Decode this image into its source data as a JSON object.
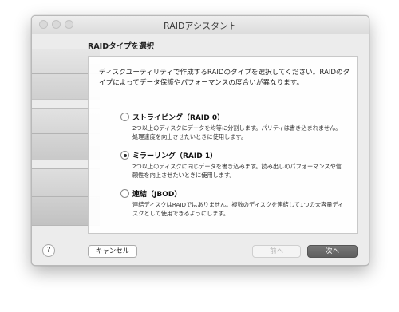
{
  "window": {
    "title": "RAIDアシスタント"
  },
  "page": {
    "heading": "RAIDタイプを選択",
    "intro": "ディスクユーティリティで作成するRAIDのタイプを選択してください。RAIDのタイプによってデータ保護やパフォーマンスの度合いが異なります。"
  },
  "options": [
    {
      "title": "ストライピング（RAID 0）",
      "desc": "2つ以上のディスクにデータを均等に分割します。パリティは書き込まれません。処理速度を向上させたいときに使用します。",
      "selected": false
    },
    {
      "title": "ミラーリング（RAID 1）",
      "desc": "2つ以上のディスクに同じデータを書き込みます。読み出しのパフォーマンスや信頼性を向上させたいときに使用します。",
      "selected": true
    },
    {
      "title": "連結（JBOD）",
      "desc": "連結ディスクはRAIDではありません。複数のディスクを連結して1つの大容量ディスクとして使用できるようにします。",
      "selected": false
    }
  ],
  "buttons": {
    "help": "?",
    "cancel": "キャンセル",
    "back": "前へ",
    "next": "次へ"
  }
}
